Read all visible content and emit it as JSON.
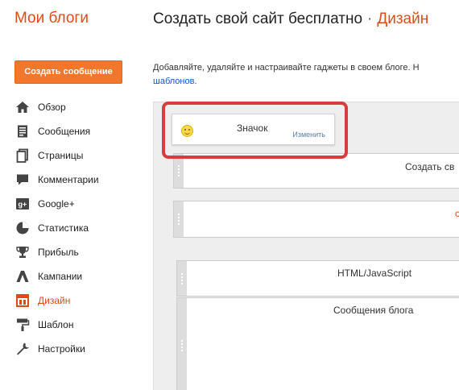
{
  "header": {
    "brand": "Мои блоги",
    "title": "Создать свой сайт бесплатно",
    "separator": "·",
    "section": "Дизайн"
  },
  "sidebar": {
    "create_button": "Создать сообщение",
    "items": [
      {
        "label": "Обзор",
        "icon": "home-icon"
      },
      {
        "label": "Сообщения",
        "icon": "posts-icon"
      },
      {
        "label": "Страницы",
        "icon": "pages-icon"
      },
      {
        "label": "Комментарии",
        "icon": "comment-icon"
      },
      {
        "label": "Google+",
        "icon": "google-plus-icon"
      },
      {
        "label": "Статистика",
        "icon": "stats-icon"
      },
      {
        "label": "Прибыль",
        "icon": "trophy-icon"
      },
      {
        "label": "Кампании",
        "icon": "campaign-icon"
      },
      {
        "label": "Дизайн",
        "icon": "layout-icon",
        "active": true
      },
      {
        "label": "Шаблон",
        "icon": "paint-roller-icon"
      },
      {
        "label": "Настройки",
        "icon": "wrench-icon"
      }
    ]
  },
  "main": {
    "description": "Добавляйте, удаляйте и настраивайте гаджеты в своем блоге. Н",
    "description_link": "шаблонов",
    "description_end": ".",
    "icon_gadget": {
      "name": "Значок",
      "edit": "Изменить"
    },
    "header_gadget": "Создать св",
    "html_gadget": "HTML/JavaScript",
    "posts_gadget": "Сообщения блога",
    "cut_letter": "с"
  },
  "colors": {
    "accent": "#dd4b16",
    "button": "#f1772d",
    "link": "#1155cc",
    "highlight": "#d93c3c"
  }
}
